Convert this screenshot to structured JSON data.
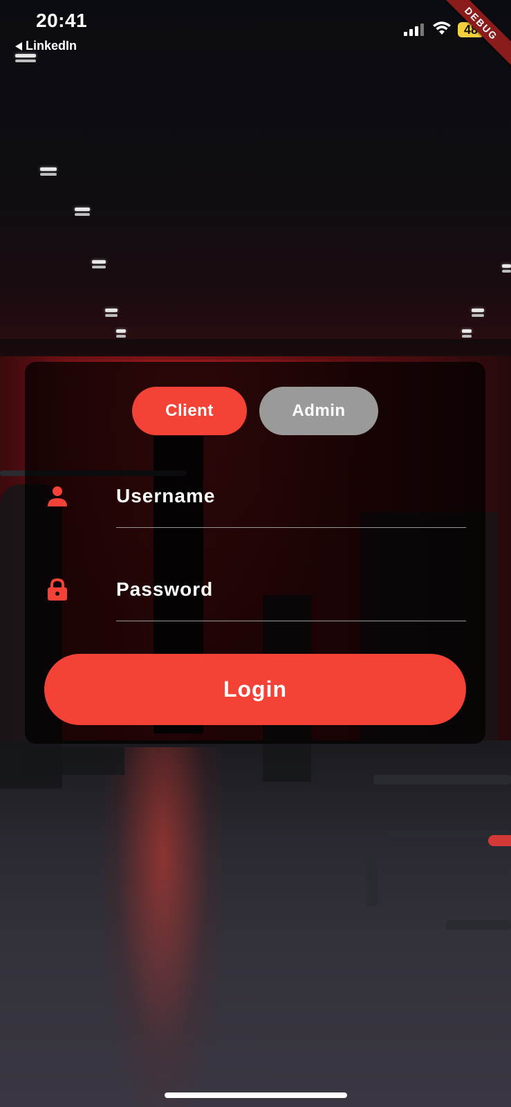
{
  "status_bar": {
    "time": "20:41",
    "back_link": "LinkedIn",
    "battery": "48",
    "debug_banner": "DEBUG"
  },
  "login": {
    "roles": [
      {
        "label": "Client",
        "selected": true
      },
      {
        "label": "Admin",
        "selected": false
      }
    ],
    "username_placeholder": "Username",
    "password_placeholder": "Password",
    "login_label": "Login"
  },
  "colors": {
    "accent": "#f44336",
    "inactive": "#9a9a9a",
    "battery": "#f4d03f"
  },
  "icons": {
    "username": "person-icon",
    "password": "lock-icon"
  }
}
